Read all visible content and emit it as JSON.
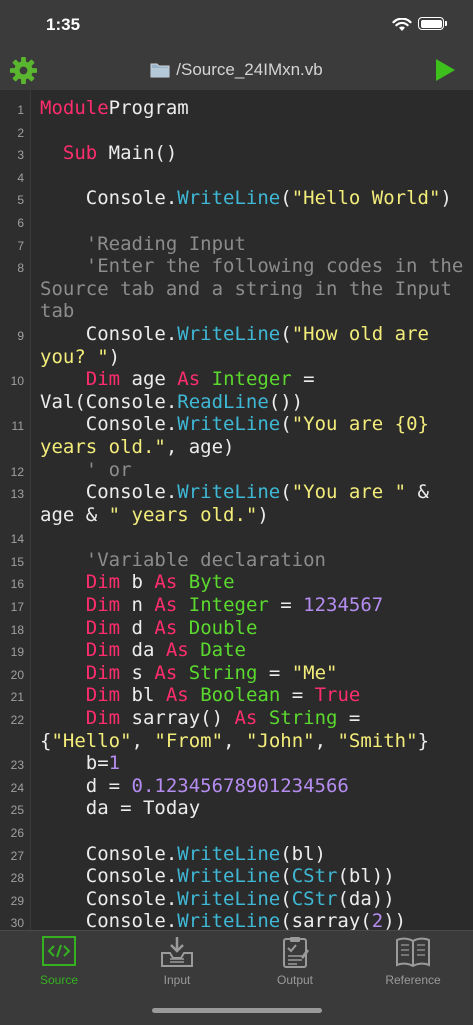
{
  "status_bar": {
    "time": "1:35"
  },
  "toolbar": {
    "file_title": "/Source_24IMxn.vb",
    "settings_icon": "gear-icon",
    "run_icon": "play-icon"
  },
  "colors": {
    "keyword": "#ff2d6e",
    "type": "#5bd92f",
    "function": "#3fb8d6",
    "string": "#f3ec7a",
    "number": "#b58cf0",
    "comment": "#8c8c8c",
    "accent": "#35b020"
  },
  "code_lines": [
    {
      "n": "1",
      "tokens": [
        [
          "kw",
          "Module"
        ],
        [
          "",
          "Program"
        ]
      ]
    },
    {
      "n": "2",
      "tokens": []
    },
    {
      "n": "3",
      "tokens": [
        [
          "",
          "  "
        ],
        [
          "kw",
          "Sub"
        ],
        [
          "",
          " Main()"
        ]
      ]
    },
    {
      "n": "4",
      "tokens": []
    },
    {
      "n": "5",
      "tokens": [
        [
          "",
          "    Console."
        ],
        [
          "fn",
          "WriteLine"
        ],
        [
          "",
          "("
        ],
        [
          "st",
          "\"Hello World\""
        ],
        [
          "",
          ")"
        ]
      ]
    },
    {
      "n": "6",
      "tokens": []
    },
    {
      "n": "7",
      "tokens": [
        [
          "cm",
          "    'Reading Input"
        ]
      ]
    },
    {
      "n": "8",
      "tokens": [
        [
          "cm",
          "    'Enter the following codes in the Source tab and a string in the Input tab"
        ]
      ]
    },
    {
      "n": "9",
      "tokens": [
        [
          "",
          "    Console."
        ],
        [
          "fn",
          "WriteLine"
        ],
        [
          "",
          "("
        ],
        [
          "st",
          "\"How old are you? \""
        ],
        [
          "",
          ")"
        ]
      ]
    },
    {
      "n": "10",
      "tokens": [
        [
          "",
          "    "
        ],
        [
          "kw",
          "Dim"
        ],
        [
          "",
          " age "
        ],
        [
          "kw",
          "As"
        ],
        [
          "",
          " "
        ],
        [
          "ty",
          "Integer"
        ],
        [
          "",
          " = Val(Console."
        ],
        [
          "fn",
          "ReadLine"
        ],
        [
          "",
          "())"
        ]
      ]
    },
    {
      "n": "11",
      "tokens": [
        [
          "",
          "    Console."
        ],
        [
          "fn",
          "WriteLine"
        ],
        [
          "",
          "("
        ],
        [
          "st",
          "\"You are {0} years old.\""
        ],
        [
          "",
          ", age)"
        ]
      ]
    },
    {
      "n": "12",
      "tokens": [
        [
          "cm",
          "    ' or"
        ]
      ]
    },
    {
      "n": "13",
      "tokens": [
        [
          "",
          "    Console."
        ],
        [
          "fn",
          "WriteLine"
        ],
        [
          "",
          "("
        ],
        [
          "st",
          "\"You are \""
        ],
        [
          "",
          " & age & "
        ],
        [
          "st",
          "\" years old.\""
        ],
        [
          "",
          ")"
        ]
      ]
    },
    {
      "n": "14",
      "tokens": []
    },
    {
      "n": "15",
      "tokens": [
        [
          "cm",
          "    'Variable declaration"
        ]
      ]
    },
    {
      "n": "16",
      "tokens": [
        [
          "",
          "    "
        ],
        [
          "kw",
          "Dim"
        ],
        [
          "",
          " b "
        ],
        [
          "kw",
          "As"
        ],
        [
          "",
          " "
        ],
        [
          "ty",
          "Byte"
        ]
      ]
    },
    {
      "n": "17",
      "tokens": [
        [
          "",
          "    "
        ],
        [
          "kw",
          "Dim"
        ],
        [
          "",
          " n "
        ],
        [
          "kw",
          "As"
        ],
        [
          "",
          " "
        ],
        [
          "ty",
          "Integer"
        ],
        [
          "",
          " = "
        ],
        [
          "nm",
          "1234567"
        ]
      ]
    },
    {
      "n": "18",
      "tokens": [
        [
          "",
          "    "
        ],
        [
          "kw",
          "Dim"
        ],
        [
          "",
          " d "
        ],
        [
          "kw",
          "As"
        ],
        [
          "",
          " "
        ],
        [
          "ty",
          "Double"
        ]
      ]
    },
    {
      "n": "19",
      "tokens": [
        [
          "",
          "    "
        ],
        [
          "kw",
          "Dim"
        ],
        [
          "",
          " da "
        ],
        [
          "kw",
          "As"
        ],
        [
          "",
          " "
        ],
        [
          "ty",
          "Date"
        ]
      ]
    },
    {
      "n": "20",
      "tokens": [
        [
          "",
          "    "
        ],
        [
          "kw",
          "Dim"
        ],
        [
          "",
          " s "
        ],
        [
          "kw",
          "As"
        ],
        [
          "",
          " "
        ],
        [
          "ty",
          "String"
        ],
        [
          "",
          " = "
        ],
        [
          "st",
          "\"Me\""
        ]
      ]
    },
    {
      "n": "21",
      "tokens": [
        [
          "",
          "    "
        ],
        [
          "kw",
          "Dim"
        ],
        [
          "",
          " bl "
        ],
        [
          "kw",
          "As"
        ],
        [
          "",
          " "
        ],
        [
          "ty",
          "Boolean"
        ],
        [
          "",
          " = "
        ],
        [
          "kw",
          "True"
        ]
      ]
    },
    {
      "n": "22",
      "tokens": [
        [
          "",
          "    "
        ],
        [
          "kw",
          "Dim"
        ],
        [
          "",
          " sarray() "
        ],
        [
          "kw",
          "As"
        ],
        [
          "",
          " "
        ],
        [
          "ty",
          "String"
        ],
        [
          "",
          " = {"
        ],
        [
          "st",
          "\"Hello\""
        ],
        [
          "",
          ", "
        ],
        [
          "st",
          "\"From\""
        ],
        [
          "",
          ", "
        ],
        [
          "st",
          "\"John\""
        ],
        [
          "",
          ", "
        ],
        [
          "st",
          "\"Smith\""
        ],
        [
          "",
          "}"
        ]
      ]
    },
    {
      "n": "23",
      "tokens": [
        [
          "",
          "    b="
        ],
        [
          "nm",
          "1"
        ]
      ]
    },
    {
      "n": "24",
      "tokens": [
        [
          "",
          "    d = "
        ],
        [
          "nm",
          "0.12345678901234566"
        ]
      ]
    },
    {
      "n": "25",
      "tokens": [
        [
          "",
          "    da = Today"
        ]
      ]
    },
    {
      "n": "26",
      "tokens": []
    },
    {
      "n": "27",
      "tokens": [
        [
          "",
          "    Console."
        ],
        [
          "fn",
          "WriteLine"
        ],
        [
          "",
          "(bl)"
        ]
      ]
    },
    {
      "n": "28",
      "tokens": [
        [
          "",
          "    Console."
        ],
        [
          "fn",
          "WriteLine"
        ],
        [
          "",
          "("
        ],
        [
          "fn",
          "CStr"
        ],
        [
          "",
          "(bl))"
        ]
      ]
    },
    {
      "n": "29",
      "tokens": [
        [
          "",
          "    Console."
        ],
        [
          "fn",
          "WriteLine"
        ],
        [
          "",
          "("
        ],
        [
          "fn",
          "CStr"
        ],
        [
          "",
          "(da))"
        ]
      ]
    },
    {
      "n": "30",
      "tokens": [
        [
          "",
          "    Console."
        ],
        [
          "fn",
          "WriteLine"
        ],
        [
          "",
          "(sarray("
        ],
        [
          "nm",
          "2"
        ],
        [
          "",
          "))"
        ]
      ]
    }
  ],
  "tabs": [
    {
      "label": "Source",
      "icon": "code-icon",
      "active": true
    },
    {
      "label": "Input",
      "icon": "input-tray-icon",
      "active": false
    },
    {
      "label": "Output",
      "icon": "clipboard-check-icon",
      "active": false
    },
    {
      "label": "Reference",
      "icon": "book-icon",
      "active": false
    }
  ]
}
